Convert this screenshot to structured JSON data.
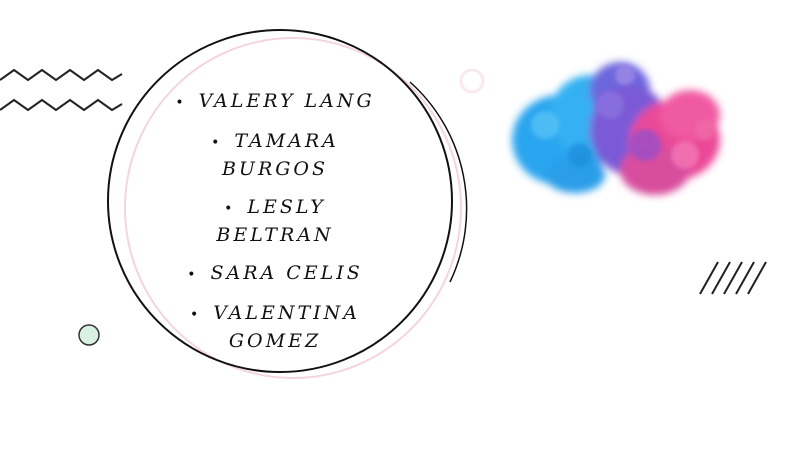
{
  "colors": {
    "zigzag": "#222222",
    "circle": "#111111",
    "circle_shadow": "#f5d4e2",
    "ring": "#fae9f1",
    "mint": "#d8f1e3",
    "mint_stroke": "#333333",
    "ink_blue": "#2aa5f0",
    "ink_purple": "#7a5ad6",
    "ink_pink": "#ea4a98"
  },
  "names": [
    "VALERY LANG",
    "TAMARA BURGOS",
    "LESLY BELTRAN",
    "SARA CELIS",
    "VALENTINA GOMEZ"
  ],
  "icons": {
    "zigzag": "zigzag-lines-icon",
    "ring": "small-ring-icon",
    "dot": "mint-dot-icon",
    "slashes": "diagonal-slashes-icon",
    "ink": "ink-cloud-image"
  }
}
